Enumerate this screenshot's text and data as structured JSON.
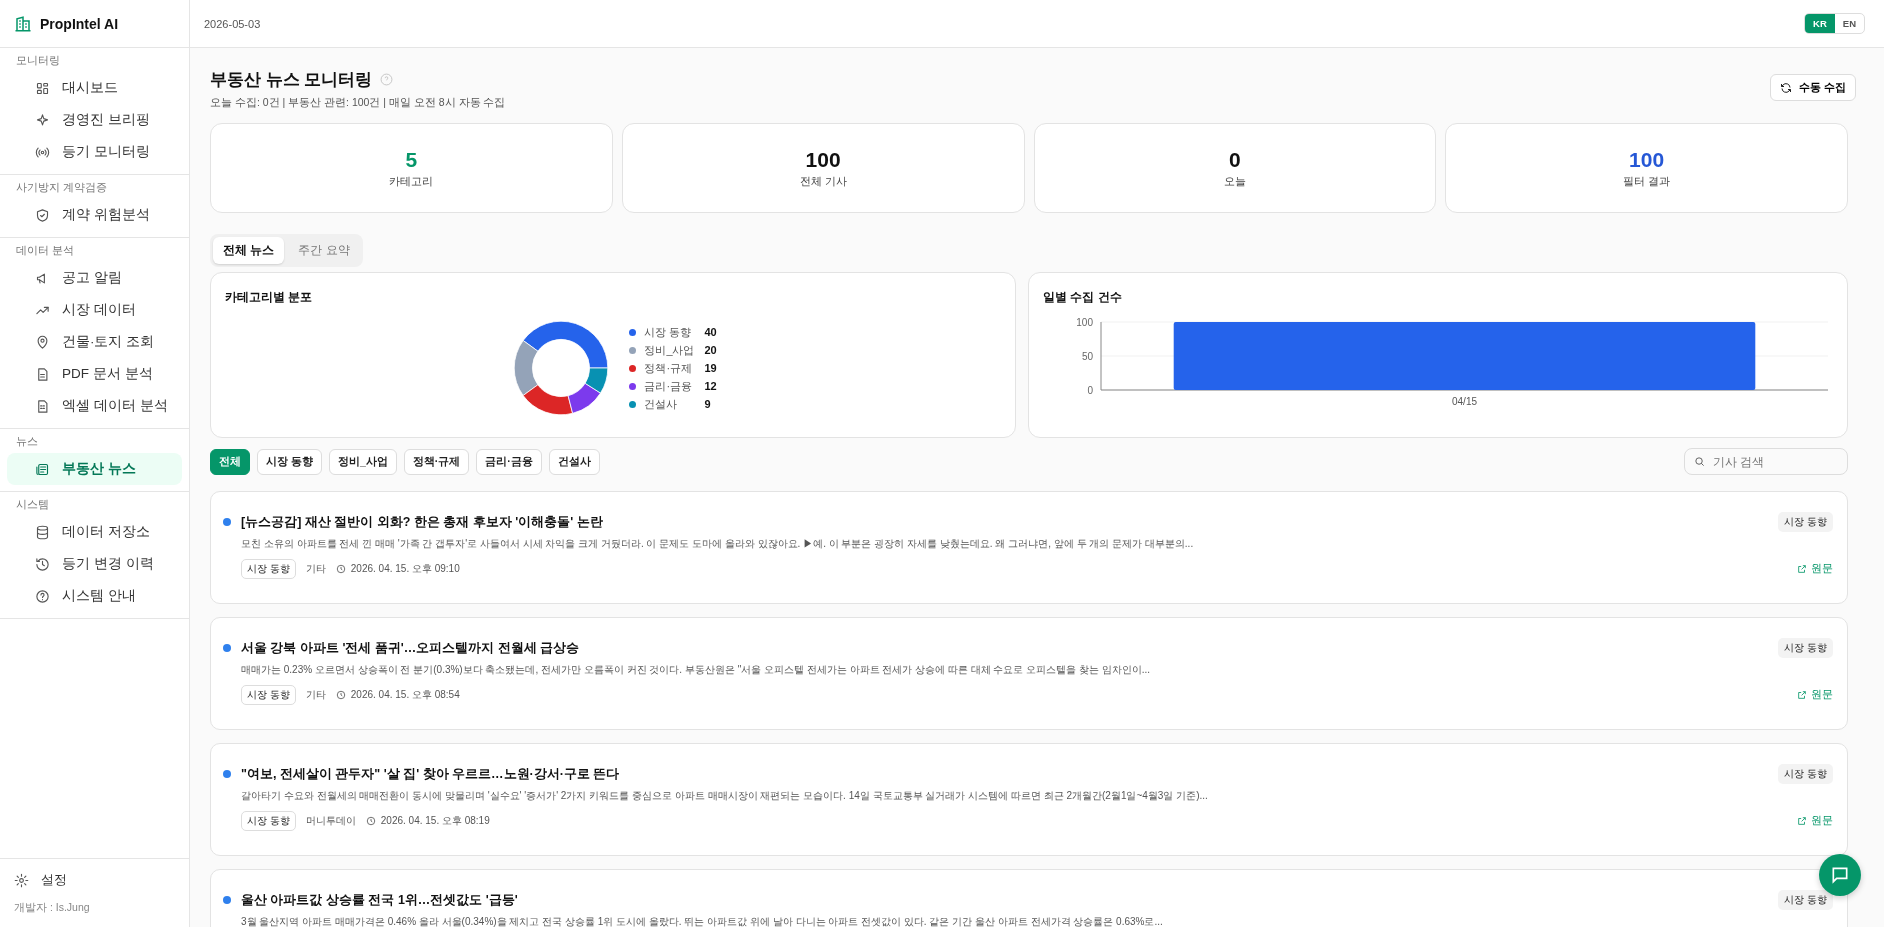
{
  "brand": {
    "name": "PropIntel AI"
  },
  "sidebar": {
    "sections": [
      {
        "title": "모니터링",
        "items": [
          {
            "label": "대시보드",
            "selected": false
          },
          {
            "label": "경영진 브리핑",
            "selected": false
          },
          {
            "label": "등기 모니터링",
            "selected": false
          }
        ]
      },
      {
        "title": "사기방지 계약검증",
        "items": [
          {
            "label": "계약 위험분석",
            "selected": false
          }
        ]
      },
      {
        "title": "데이터 분석",
        "items": [
          {
            "label": "공고 알림",
            "selected": false
          },
          {
            "label": "시장 데이터",
            "selected": false
          },
          {
            "label": "건물·토지 조회",
            "selected": false
          },
          {
            "label": "PDF 문서 분석",
            "selected": false
          },
          {
            "label": "엑셀 데이터 분석",
            "selected": false
          }
        ]
      },
      {
        "title": "뉴스",
        "items": [
          {
            "label": "부동산 뉴스",
            "selected": true
          }
        ]
      },
      {
        "title": "시스템",
        "items": [
          {
            "label": "데이터 저장소",
            "selected": false
          },
          {
            "label": "등기 변경 이력",
            "selected": false
          },
          {
            "label": "시스템 안내",
            "selected": false
          }
        ]
      }
    ],
    "settings": "설정",
    "developer": "개발자 : Is.Jung"
  },
  "header": {
    "date": "2026-05-03",
    "languages": [
      {
        "label": "KR",
        "selected": true
      },
      {
        "label": "EN",
        "selected": false
      }
    ]
  },
  "page": {
    "title": "부동산 뉴스 모니터링",
    "subtitle": "오늘 수집: 0건 | 부동산 관련: 100건 | 매일 오전 8시 자동 수집",
    "action": "수동 수집"
  },
  "stats": [
    {
      "value": "5",
      "label": "카테고리",
      "color": "#059669"
    },
    {
      "value": "100",
      "label": "전체 기사",
      "color": "#111111"
    },
    {
      "value": "0",
      "label": "오늘",
      "color": "#111111"
    },
    {
      "value": "100",
      "label": "필터 결과",
      "color": "#2557d6"
    }
  ],
  "tabs": [
    {
      "label": "전체 뉴스",
      "selected": true
    },
    {
      "label": "주간 요약",
      "selected": false
    }
  ],
  "category_chart": {
    "title": "카테고리별 분포",
    "chart_data": {
      "type": "donut",
      "categories": [
        "시장 동향",
        "정비_사업",
        "정책·규제",
        "금리·금융",
        "건설사"
      ],
      "values": [
        40,
        20,
        19,
        12,
        9
      ],
      "colors": [
        "#2563eb",
        "#94a3b8",
        "#dc2626",
        "#7c3aed",
        "#0891b2"
      ],
      "value_labels": [
        "40",
        "20",
        "19",
        "12",
        "9"
      ],
      "legend": "right"
    }
  },
  "daily_chart": {
    "title": "일별 수집 건수",
    "chart_data": {
      "type": "bar",
      "categories": [
        "04/15"
      ],
      "series": [
        {
          "color": "#2563eb",
          "values": [
            100
          ]
        }
      ],
      "yticks": [
        0,
        50,
        100
      ],
      "ylim": [
        0,
        100
      ]
    }
  },
  "filters": [
    {
      "label": "전체",
      "selected": true
    },
    {
      "label": "시장 동향",
      "selected": false
    },
    {
      "label": "정비_사업",
      "selected": false
    },
    {
      "label": "정책·규제",
      "selected": false
    },
    {
      "label": "금리·금융",
      "selected": false
    },
    {
      "label": "건설사",
      "selected": false
    }
  ],
  "search": {
    "placeholder": "기사 검색"
  },
  "articles": [
    {
      "title": "[뉴스공감] 재산 절반이 외화? 한은 총재 후보자 '이해충돌' 논란",
      "summary": "모친 소유의 아파트를 전세 낀 매매 '가족 간 갭투자'로 사들여서 시세 차익을 크게 거뒀더라. 이 문제도 도마에 올라와 있잖아요. ▶예. 이 부분은 굉장히 자세를 낮췄는데요. 왜 그러냐면, 앞에 두 개의 문제가 대부분의...",
      "category": "시장 동향",
      "tag": "시장 동향",
      "source": "기타",
      "time": "2026. 04. 15. 오후 09:10",
      "link": "원문"
    },
    {
      "title": "서울 강북 아파트 '전세 품귀'…오피스텔까지 전월세 급상승",
      "summary": "매매가는 0.23% 오르면서 상승폭이 전 분기(0.3%)보다 축소됐는데, 전세가만 오름폭이 커진 것이다. 부동산원은 \"서울 오피스텔 전세가는 아파트 전세가 상승에 따른 대체 수요로 오피스텔을 찾는 임차인이...",
      "category": "시장 동향",
      "tag": "시장 동향",
      "source": "기타",
      "time": "2026. 04. 15. 오후 08:54",
      "link": "원문"
    },
    {
      "title": "\"여보, 전세살이 관두자\" '살 집' 찾아 우르르…노원·강서·구로 뜬다",
      "summary": "갈아타기 수요와 전월세의 매매전환이 동시에 맞물리며 '실수요' '증서가' 2가지 키워드를 중심으로 아파트 매매시장이 재편되는 모습이다. 14일 국토교통부 실거래가 시스템에 따르면 최근 2개월간(2월1일~4월3일 기준)...",
      "category": "시장 동향",
      "tag": "시장 동향",
      "source": "머니투데이",
      "time": "2026. 04. 15. 오후 08:19",
      "link": "원문"
    },
    {
      "title": "울산 아파트값 상승률 전국 1위…전셋값도 '급등'",
      "summary": "3월 울산지역 아파트 매매가격은 0.46% 올라 서울(0.34%)을 제치고 전국 상승률 1위 도시에 올랐다. 뛰는 아파트값 위에 날아 다니는 아파트 전셋값이 있다. 같은 기간 울산 아파트 전세가격 상승률은 0.63%로...",
      "category": "시장 동향"
    }
  ]
}
